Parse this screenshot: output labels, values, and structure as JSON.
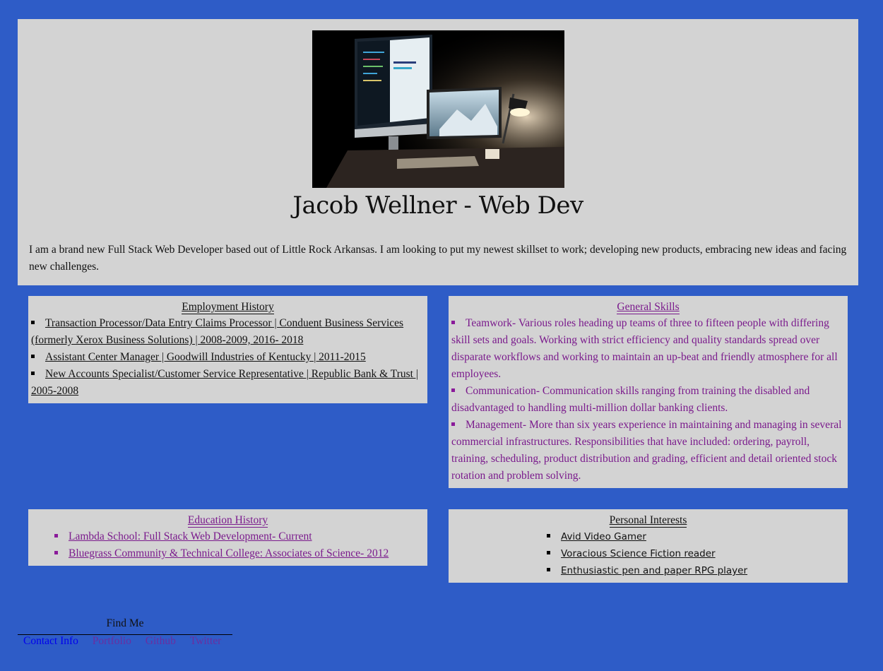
{
  "header": {
    "title": "Jacob Wellner - Web Dev",
    "bio": "I am a brand new Full Stack Web Developer based out of Little Rock Arkansas. I am looking to put my newest skillset to work; developing new products, embracing new ideas and facing new challenges."
  },
  "employment": {
    "title": "Employment History",
    "items": [
      "Transaction Processor/Data Entry Claims Processor | Conduent Business Services (formerly Xerox Business Solutions) | 2008-2009, 2016- 2018",
      "Assistant Center Manager | Goodwill Industries of Kentucky | 2011-2015",
      "New Accounts Specialist/Customer Service Representative | Republic Bank & Trust | 2005-2008"
    ]
  },
  "skills": {
    "title": "General Skills",
    "items": [
      "Teamwork- Various roles heading up teams of three to fifteen people with differing skill sets and goals. Working with strict efficiency and quality standards spread over disparate workflows and working to maintain an up-beat and friendly atmosphere for all employees.",
      "Communication- Communication skills ranging from training the disabled and disadvantaged to handling multi-million dollar banking clients.",
      "Management- More than six years experience in maintaining and managing in several commercial infrastructures. Responsibilities that have included: ordering, payroll, training, scheduling, product distribution and grading, efficient and detail oriented stock rotation and problem solving."
    ]
  },
  "education": {
    "title": "Education History",
    "items": [
      "Lambda School: Full Stack Web Development- Current",
      "Bluegrass Community & Technical College: Associates of Science- 2012"
    ]
  },
  "interests": {
    "title": "Personal Interests",
    "items": [
      "Avid Video Gamer",
      "Voracious Science Fiction reader",
      "Enthusiastic pen and paper RPG player"
    ]
  },
  "footer": {
    "heading": "Find Me",
    "links": [
      {
        "label": "Contact Info",
        "color": "#0000ee"
      },
      {
        "label": "Portfolio",
        "color": "#6a2ea0"
      },
      {
        "label": "Github",
        "color": "#6a2ea0"
      },
      {
        "label": "Twitter",
        "color": "#6a2ea0"
      }
    ]
  },
  "colors": {
    "background": "#2e5cc7",
    "panel": "#d3d3d3",
    "visited": "#7a1a8c"
  }
}
